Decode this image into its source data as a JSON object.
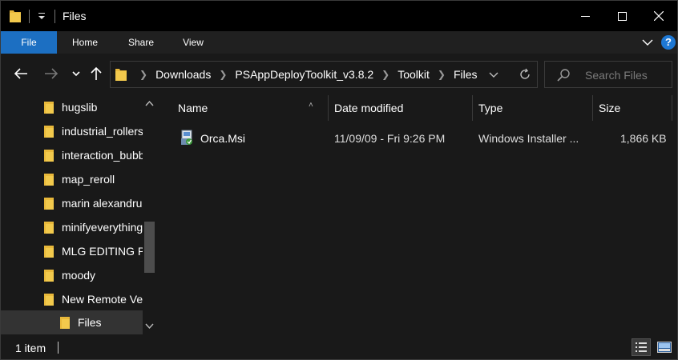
{
  "window": {
    "title": "Files"
  },
  "ribbon": {
    "tabs": [
      "File",
      "Home",
      "Share",
      "View"
    ],
    "help_label": "?"
  },
  "address": {
    "crumbs": [
      "Downloads",
      "PSAppDeployToolkit_v3.8.2",
      "Toolkit",
      "Files"
    ]
  },
  "search": {
    "placeholder": "Search Files"
  },
  "nav_pane": {
    "items": [
      "hugslib",
      "industrial_rollers",
      "interaction_bubbles",
      "map_reroll",
      "marin alexandru",
      "minifyeverything",
      "MLG EDITING PACK",
      "moody",
      "New Remote Vehicles",
      "Files"
    ],
    "selected": "Files"
  },
  "file_list": {
    "columns": [
      "Name",
      "Date modified",
      "Type",
      "Size"
    ],
    "rows": [
      {
        "name": "Orca.Msi",
        "date_modified": "11/09/09 - Fri 9:26 PM",
        "type": "Windows Installer ...",
        "size": "1,866 KB",
        "icon": "msi-installer-icon"
      }
    ]
  },
  "status": {
    "item_count": "1 item"
  },
  "colors": {
    "accent": "#1c6fc2",
    "folder": "#e8b83a",
    "background": "#191919"
  }
}
